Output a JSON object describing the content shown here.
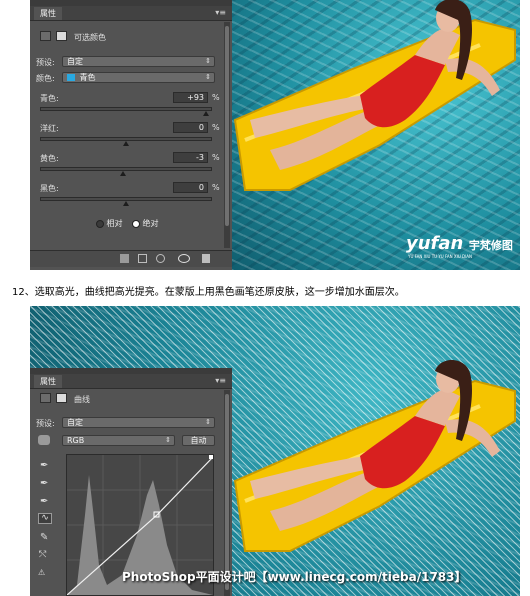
{
  "panel1": {
    "tab_label": "属性",
    "menu_glyph": "▾≡",
    "adjustment_title": "可选颜色",
    "preset_label": "预设:",
    "preset_value": "自定",
    "colors_label": "颜色:",
    "colors_value": "青色",
    "colors_swatch": "#29a9e1",
    "sliders": [
      {
        "label": "青色:",
        "value": "+93",
        "unit": "%",
        "position": 0.965
      },
      {
        "label": "洋红:",
        "value": "0",
        "unit": "%",
        "position": 0.5
      },
      {
        "label": "黄色:",
        "value": "-3",
        "unit": "%",
        "position": 0.485
      },
      {
        "label": "黑色:",
        "value": "0",
        "unit": "%",
        "position": 0.5
      }
    ],
    "radio_relative": "相对",
    "radio_absolute": "绝对",
    "selected_method": "absolute"
  },
  "watermark1": {
    "brand": "yufan",
    "brand_cn": "宇梵修图",
    "sub": "YU FAN XIU TU YU FAN XIU DIAN"
  },
  "caption": "12、选取高光，曲线把高光提亮。在蒙版上用黑色画笔还原皮肤，这一步增加水面层次。",
  "panel2": {
    "tab_label": "属性",
    "menu_glyph": "▾≡",
    "adjustment_title": "曲线",
    "preset_label": "预设:",
    "preset_value": "自定",
    "channel_value": "RGB",
    "auto_label": "自动"
  },
  "watermark2": "PhotoShop平面设计吧【www.linecg.com/tieba/1783】",
  "colors": {
    "panel_bg": "#535353",
    "swimsuit": "#d8201f",
    "float": "#f5c400"
  }
}
